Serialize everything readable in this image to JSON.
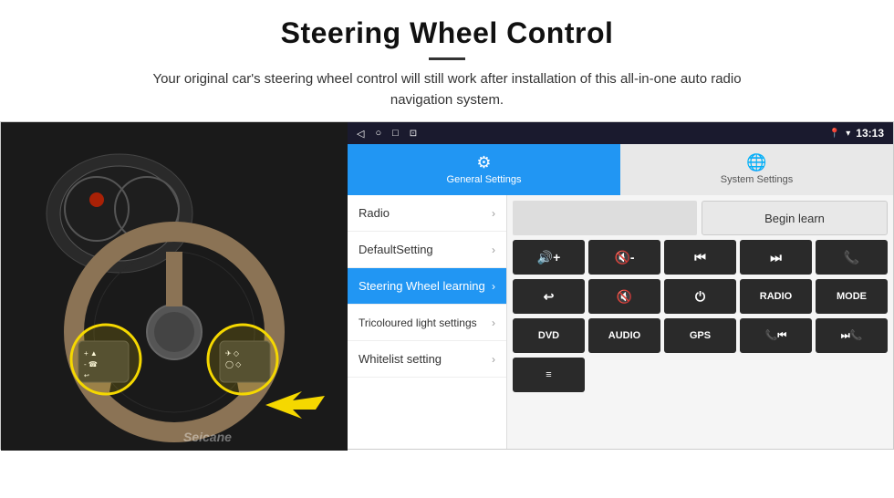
{
  "header": {
    "title": "Steering Wheel Control",
    "subtitle": "Your original car's steering wheel control will still work after installation of this all-in-one auto radio navigation system."
  },
  "statusBar": {
    "time": "13:13",
    "navIcons": [
      "◁",
      "○",
      "□",
      "⊡"
    ]
  },
  "tabs": [
    {
      "id": "general",
      "label": "General Settings",
      "active": true
    },
    {
      "id": "system",
      "label": "System Settings",
      "active": false
    }
  ],
  "menuItems": [
    {
      "id": "radio",
      "label": "Radio",
      "active": false
    },
    {
      "id": "default",
      "label": "DefaultSetting",
      "active": false
    },
    {
      "id": "steering",
      "label": "Steering Wheel learning",
      "active": true
    },
    {
      "id": "tricoloured",
      "label": "Tricoloured light settings",
      "active": false
    },
    {
      "id": "whitelist",
      "label": "Whitelist setting",
      "active": false
    }
  ],
  "controls": {
    "beginLearnLabel": "Begin learn",
    "row1": [
      {
        "id": "vol-up",
        "symbol": "🔊+"
      },
      {
        "id": "vol-down",
        "symbol": "🔇-"
      },
      {
        "id": "prev",
        "symbol": "⏮"
      },
      {
        "id": "next",
        "symbol": "⏭"
      },
      {
        "id": "phone",
        "symbol": "📞"
      }
    ],
    "row2": [
      {
        "id": "hangup",
        "symbol": "↩"
      },
      {
        "id": "mute",
        "symbol": "🔇"
      },
      {
        "id": "power",
        "symbol": "⏻"
      },
      {
        "id": "radio-btn",
        "symbol": "RADIO",
        "text": true
      },
      {
        "id": "mode-btn",
        "symbol": "MODE",
        "text": true
      }
    ],
    "row3": [
      {
        "id": "dvd",
        "symbol": "DVD",
        "text": true
      },
      {
        "id": "audio",
        "symbol": "AUDIO",
        "text": true
      },
      {
        "id": "gps",
        "symbol": "GPS",
        "text": true
      },
      {
        "id": "phone2",
        "symbol": "📞⏮"
      },
      {
        "id": "next2",
        "symbol": "⏭📞"
      }
    ],
    "row4": [
      {
        "id": "menu-icon",
        "symbol": "≡"
      }
    ]
  }
}
